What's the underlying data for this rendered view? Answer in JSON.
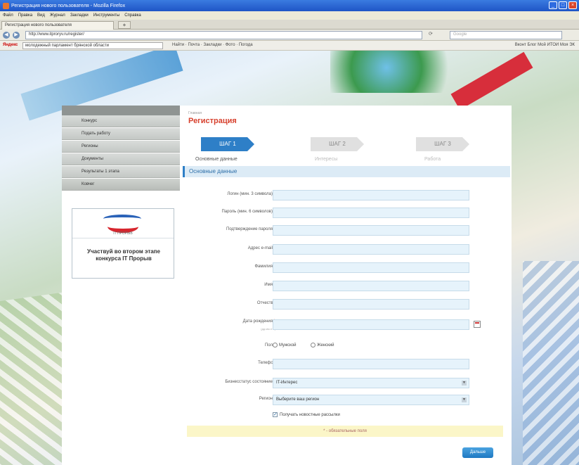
{
  "window": {
    "title": "Регистрация нового пользователя - Mozilla Firefox",
    "controls": [
      "_",
      "□",
      "×"
    ]
  },
  "menubar": [
    "Файл",
    "Правка",
    "Вид",
    "Журнал",
    "Закладки",
    "Инструменты",
    "Справка"
  ],
  "tab": {
    "label": "Регистрация нового пользователя",
    "new_tab": "+"
  },
  "nav": {
    "back": "◀",
    "forward": "▶",
    "url": "http://www.itproryv.ru/register/",
    "reload": "⟳",
    "search_placeholder": "Google"
  },
  "yandex_bar": {
    "label": "Яндекс",
    "search_value": "молодежный парламент брянской области",
    "tools": "Найти · Почта · Закладки · Фото · Погода",
    "right": "Вконт  Блог  Мой ИТОИ  Моя ЭК"
  },
  "sidebar": {
    "items": [
      {
        "label": "Конкурс"
      },
      {
        "label": "Подать работу"
      },
      {
        "label": "Регионы"
      },
      {
        "label": "Документы"
      },
      {
        "label": "Результаты 1 этапа"
      },
      {
        "label": "Ковчег"
      }
    ],
    "promo": {
      "brand": "IT ПРОРЫВ",
      "text": "Участвуй во втором этапе конкурса IT Прорыв"
    }
  },
  "breadcrumb": "Главная",
  "page_title": "Регистрация",
  "steps": [
    {
      "label": "ШАГ 1",
      "caption": "Основные данные"
    },
    {
      "label": "ШАГ 2",
      "caption": "Интересы"
    },
    {
      "label": "ШАГ 3",
      "caption": "Работа"
    }
  ],
  "section_title": "Основные данные",
  "form": {
    "login": {
      "label": "Логин (мин. 3 символа)",
      "value": ""
    },
    "password": {
      "label": "Пароль (мин. 6 символов)",
      "value": ""
    },
    "password_confirm": {
      "label": "Подтверждение пароля",
      "value": ""
    },
    "email": {
      "label": "Адрес e-mail",
      "value": ""
    },
    "last_name": {
      "label": "Фамилия",
      "value": ""
    },
    "first_name": {
      "label": "Имя",
      "value": ""
    },
    "middle_name": {
      "label": "Отчество",
      "value": ""
    },
    "birthdate": {
      "label": "Дата рождения",
      "hint": "(дд.мм.гггг)",
      "value": ""
    },
    "gender": {
      "label": "Пол",
      "options": [
        "Мужской",
        "Женский"
      ]
    },
    "phone": {
      "label": "Телефон",
      "value": ""
    },
    "business_status": {
      "label": "Бизнесстатус состояние",
      "value": "IT-Интерес"
    },
    "region": {
      "label": "Регион",
      "value": "Выберите ваш регион"
    },
    "subscribe": {
      "label": "Получать новостные рассылки"
    },
    "required_note": "* - обязательные поля",
    "required_mark": "*",
    "submit": "Дальше"
  },
  "colors": {
    "accent": "#2e7fc7",
    "title_red": "#d7402d",
    "field_bg": "#e6f3fb"
  }
}
